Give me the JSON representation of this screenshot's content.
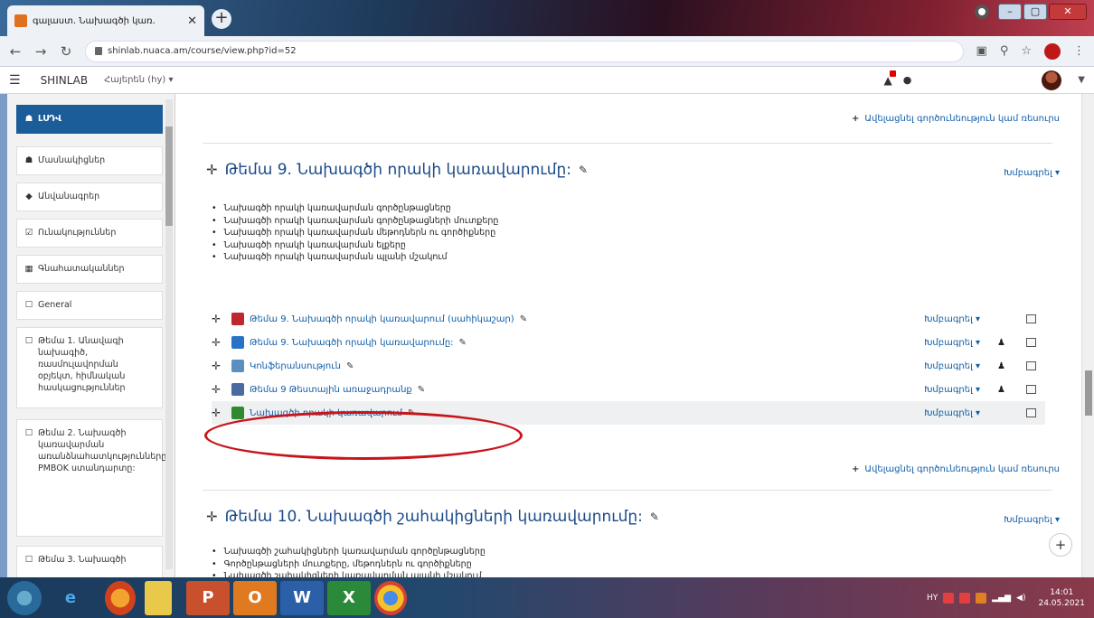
{
  "browser": {
    "tab_title": "գալաստ. Նախագծի կառ.",
    "tab_close": "✕",
    "new_tab": "+",
    "url": "shinlab.nuaca.am/course/view.php?id=52"
  },
  "navbar": {
    "brand": "SHINLAB",
    "language": "Հայերեն (hy) ▾"
  },
  "drawer": {
    "items": [
      {
        "icon": "☗",
        "label": "ԼՍԴՎ",
        "active": true
      },
      {
        "icon": "☗",
        "label": "Մասնակիցներ"
      },
      {
        "icon": "◆",
        "label": "Անվանագրեր"
      },
      {
        "icon": "☑",
        "label": "Ունակություններ"
      },
      {
        "icon": "▦",
        "label": "Գնահատականներ"
      },
      {
        "icon": "☐",
        "label": "General"
      },
      {
        "icon": "☐",
        "label": "Թեմա 1. Անավագի նախագիծ, ռասմուլավորման օբյեկտ, հիմնական հասկացություններ"
      },
      {
        "icon": "☐",
        "label": "Թեմա 2. Նախագծի կառավարման առանձնահատկությունները: PMBOK ստանդարտը:"
      },
      {
        "icon": "☐",
        "label": "Թեմա 3. Նախագծի"
      }
    ]
  },
  "main": {
    "add_activity": "Ավելացնել գործունեություն կամ ռեսուրս",
    "edit_label": "Խմբագրել ▾",
    "section9": {
      "title": "Թեմա 9. Նախագծի որակի կառավարումը:",
      "summary": [
        "Նախագծի որակի կառավարման գործընթացները",
        "Նախագծի որակի կառավարման գործընթացների մուտքերը",
        "Նախագծի որակի կառավարման մեթոդներն ու գործիքները",
        "Նախագծի որակի կառավարման ելքերը",
        "Նախագծի որակի կառավարման պլանի մշակում"
      ],
      "activities": [
        {
          "name": "Թեմա 9. Նախագծի որակի կառավարում (սահիկաշար)",
          "edit": "Խմբագրել ▾",
          "icon_color": "#c0262d"
        },
        {
          "name": "Թեմա 9. Նախագծի որակի կառավարումը:",
          "edit": "Խմբագրել ▾",
          "icon_color": "#2a72c8",
          "person": true
        },
        {
          "name": "Կոնֆերանսություն",
          "edit": "Խմբագրել ▾",
          "icon_color": "#5a8fbf",
          "person": true
        },
        {
          "name": "Թեմա 9 Թեստային առաջադրանք",
          "edit": "Խմբագրել ▾",
          "icon_color": "#4a6aa0",
          "person": true
        },
        {
          "name": "Նախագծի որակի կառավարում",
          "edit": "Խմբագրել ▾",
          "icon_color": "#2f8a2f"
        }
      ]
    },
    "section10": {
      "title": "Թեմա 10. Նախագծի շահակիցների կառավարումը:",
      "summary": [
        "Նախագծի շահակիցների կառավարման գործընթացները",
        "Գործընթացների մուտքերը, մեթոդներն ու գործիքները",
        "Նախագծի շահակիցների կառավարման պլանի մշակում"
      ]
    }
  },
  "taskbar": {
    "time": "14:01",
    "date": "24.05.2021",
    "lang": "HY"
  }
}
